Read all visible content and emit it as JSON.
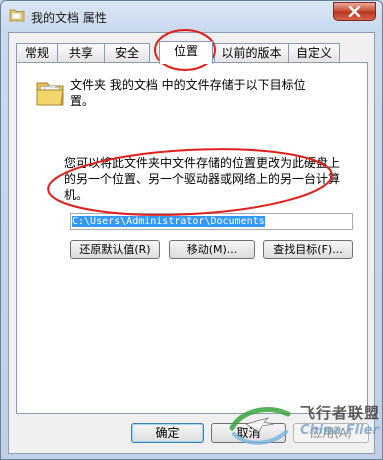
{
  "window": {
    "title": "我的文档 属性",
    "close_icon": "close-icon"
  },
  "tabs": [
    {
      "label": "常规"
    },
    {
      "label": "共享"
    },
    {
      "label": "安全"
    },
    {
      "label": "位置",
      "active": true
    },
    {
      "label": "以前的版本"
    },
    {
      "label": "自定义"
    }
  ],
  "location": {
    "description_line1": "文件夹 我的文档 中的文件存储于以下目标位",
    "description_line2": "置。",
    "info_line1": "您可以将此文件夹中文件存储的位置更改为此硬盘上",
    "info_line2": "的另一个位置、另一个驱动器或网络上的另一台计算",
    "info_line3": "机。",
    "path_value": "C:\\Users\\Administrator\\Documents",
    "restore_default_label": "还原默认值(R)",
    "move_label": "移动(M)...",
    "find_target_label": "查找目标(F)..."
  },
  "footer": {
    "ok_label": "确定",
    "cancel_label": "取消",
    "apply_label": "应用(A)"
  },
  "watermark": {
    "cn": "飞行者联盟",
    "en": "China Flier"
  },
  "colors": {
    "annotation": "#e0201a",
    "selection": "#3399ff"
  }
}
